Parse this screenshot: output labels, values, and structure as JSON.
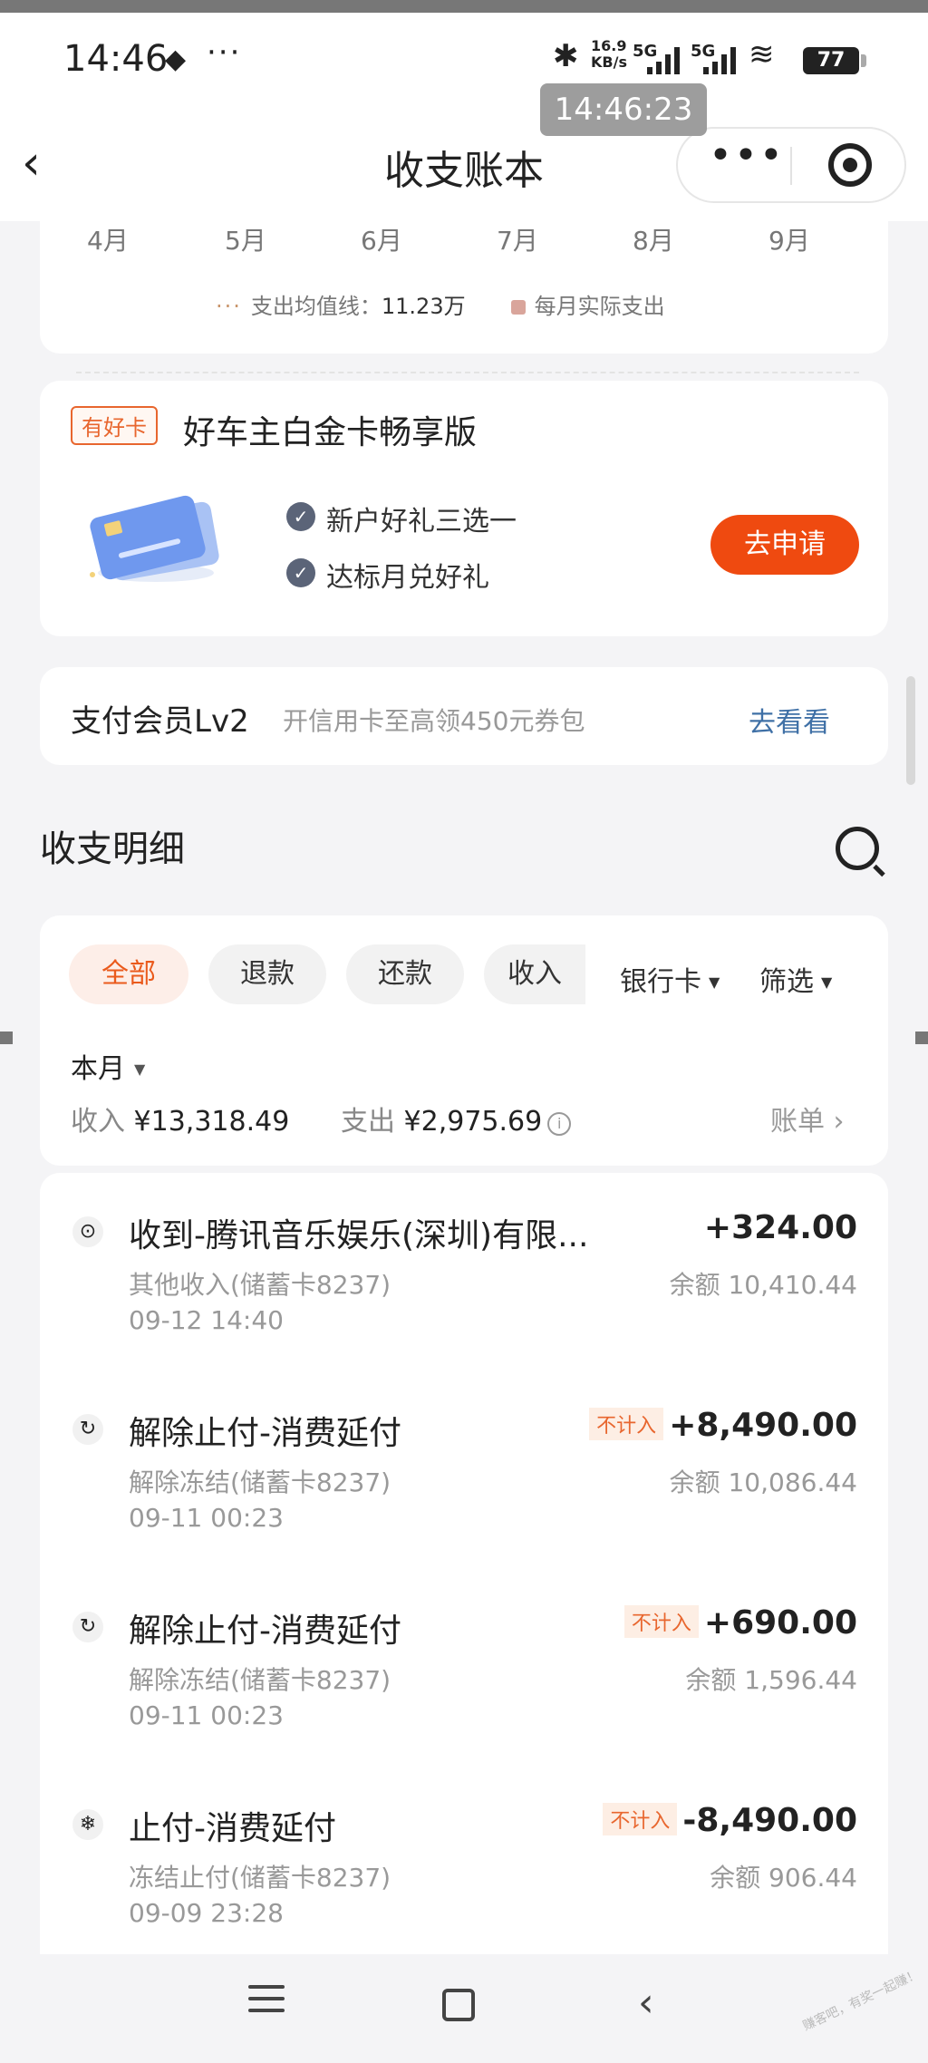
{
  "status_bar": {
    "time": "14:46",
    "net_speed_value": "16.9",
    "net_speed_unit": "KB/s",
    "signal1": "5G",
    "signal2": "5G",
    "battery": "77",
    "timestamp_overlay": "14:46:23"
  },
  "header": {
    "title": "收支账本",
    "back_icon": "chevron-left-icon",
    "more_icon": "more-dots-icon",
    "close_icon": "target-close-icon"
  },
  "chart_tail": {
    "months": [
      "4月",
      "5月",
      "6月",
      "7月",
      "8月",
      "9月"
    ],
    "legend_avg_label": "支出均值线：",
    "legend_avg_value": "11.23万",
    "legend_actual_label": "每月实际支出"
  },
  "promo": {
    "badge": "有好卡",
    "title": "好车主白金卡畅享版",
    "perks": [
      "新户好礼三选一",
      "达标月兑好礼"
    ],
    "apply_label": "去申请"
  },
  "member": {
    "title": "支付会员Lv2",
    "desc": "开信用卡至高领450元券包",
    "link": "去看看"
  },
  "details": {
    "title": "收支明细",
    "chips": [
      "全部",
      "退款",
      "还款",
      "收入"
    ],
    "active_chip": "全部",
    "dropdowns": [
      "银行卡",
      "筛选"
    ],
    "period": "本月",
    "income_label": "收入",
    "income_value": "¥13,318.49",
    "expense_label": "支出",
    "expense_value": "¥2,975.69",
    "bill_link": "账单"
  },
  "transactions": [
    {
      "icon": "target-icon",
      "title": "收到-腾讯音乐娱乐(深圳)有限...",
      "sub": "其他收入(储蓄卡8237)",
      "time": "09-12 14:40",
      "tag": "",
      "amount": "+324.00",
      "balance": "余额 10,410.44"
    },
    {
      "icon": "refresh-icon",
      "title": "解除止付-消费延付",
      "sub": "解除冻结(储蓄卡8237)",
      "time": "09-11 00:23",
      "tag": "不计入",
      "amount": "+8,490.00",
      "balance": "余额 10,086.44"
    },
    {
      "icon": "refresh-icon",
      "title": "解除止付-消费延付",
      "sub": "解除冻结(储蓄卡8237)",
      "time": "09-11 00:23",
      "tag": "不计入",
      "amount": "+690.00",
      "balance": "余额 1,596.44"
    },
    {
      "icon": "snowflake-icon",
      "title": "止付-消费延付",
      "sub": "冻结止付(储蓄卡8237)",
      "time": "09-09 23:28",
      "tag": "不计入",
      "amount": "-8,490.00",
      "balance": "余额 906.44"
    }
  ],
  "watermark": "赚客吧，有奖一起赚！"
}
